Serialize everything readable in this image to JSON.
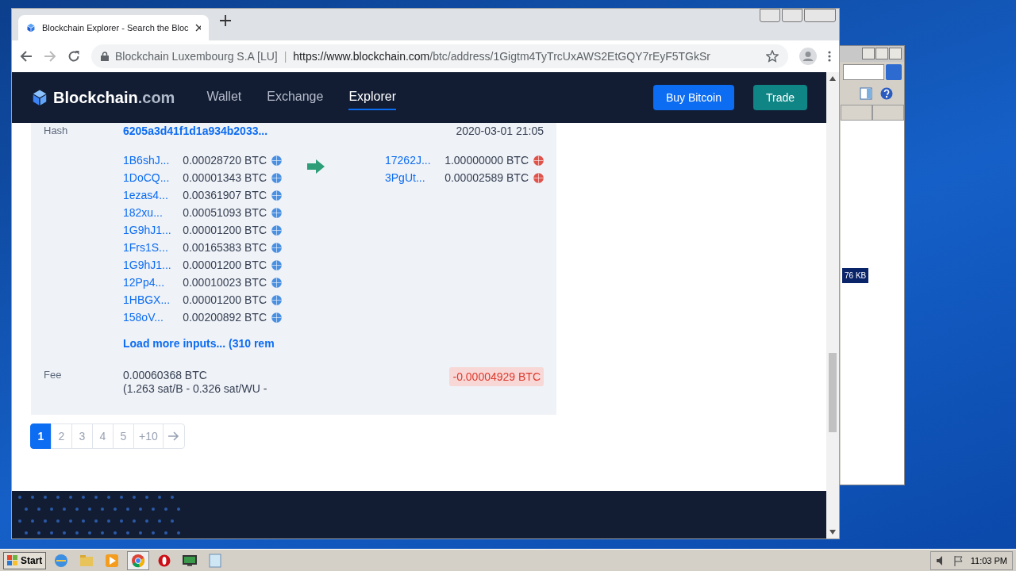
{
  "browser": {
    "tab": {
      "title": "Blockchain Explorer - Search the Bloc"
    },
    "address": {
      "site": "Blockchain Luxembourg S.A [LU]",
      "separator": "|",
      "host": "https://www.blockchain.com",
      "path": "/btc/address/1Gigtm4TyTrcUxAWS2EtGQY7rEyF5TGkSr"
    }
  },
  "site_nav": {
    "logo": "Blockchain",
    "logo_suffix": ".com",
    "links": [
      {
        "label": "Wallet",
        "selected": false
      },
      {
        "label": "Exchange",
        "selected": false
      },
      {
        "label": "Explorer",
        "selected": true
      }
    ],
    "buttons": [
      {
        "label": "Buy Bitcoin",
        "kind": "primary"
      },
      {
        "label": "Trade",
        "kind": "secondary"
      }
    ]
  },
  "transaction": {
    "hash_label": "Hash",
    "hash": "6205a3d41f1d1a934b2033...",
    "time": "2020-03-01 21:05",
    "inputs": [
      {
        "address": "1B6shJ...",
        "amount": "0.00028720 BTC",
        "color": "#4a90e2"
      },
      {
        "address": "1DoCQ...",
        "amount": "0.00001343 BTC",
        "color": "#4a90e2"
      },
      {
        "address": "1ezas4...",
        "amount": "0.00361907 BTC",
        "color": "#4a90e2"
      },
      {
        "address": "182xu...",
        "amount": "0.00051093 BTC",
        "color": "#4a90e2"
      },
      {
        "address": "1G9hJ1...",
        "amount": "0.00001200 BTC",
        "color": "#4a90e2"
      },
      {
        "address": "1Frs1S...",
        "amount": "0.00165383 BTC",
        "color": "#4a90e2"
      },
      {
        "address": "1G9hJ1...",
        "amount": "0.00001200 BTC",
        "color": "#4a90e2"
      },
      {
        "address": "12Pp4...",
        "amount": "0.00010023 BTC",
        "color": "#4a90e2"
      },
      {
        "address": "1HBGX...",
        "amount": "0.00001200 BTC",
        "color": "#4a90e2"
      },
      {
        "address": "158oV...",
        "amount": "0.00200892 BTC",
        "color": "#4a90e2"
      }
    ],
    "outputs": [
      {
        "address": "17262J...",
        "amount": "1.00000000 BTC",
        "color": "#e0534a"
      },
      {
        "address": "3PgUt...",
        "amount": "0.00002589 BTC",
        "color": "#e0534a"
      }
    ],
    "load_more": "Load more inputs... (310 rem",
    "fee_label": "Fee",
    "fee": "0.00060368 BTC",
    "fee_rate": "(1.263 sat/B - 0.326 sat/WU -",
    "balance_change": "-0.00004929 BTC"
  },
  "pagination": [
    {
      "label": "1",
      "selected": true
    },
    {
      "label": "2",
      "selected": false
    },
    {
      "label": "3",
      "selected": false
    },
    {
      "label": "4",
      "selected": false
    },
    {
      "label": "5",
      "selected": false
    },
    {
      "label": "+10",
      "selected": false
    }
  ],
  "background_window": {
    "size_badge": "76 KB"
  },
  "taskbar": {
    "start": "Start",
    "clock": "11:03 PM"
  }
}
